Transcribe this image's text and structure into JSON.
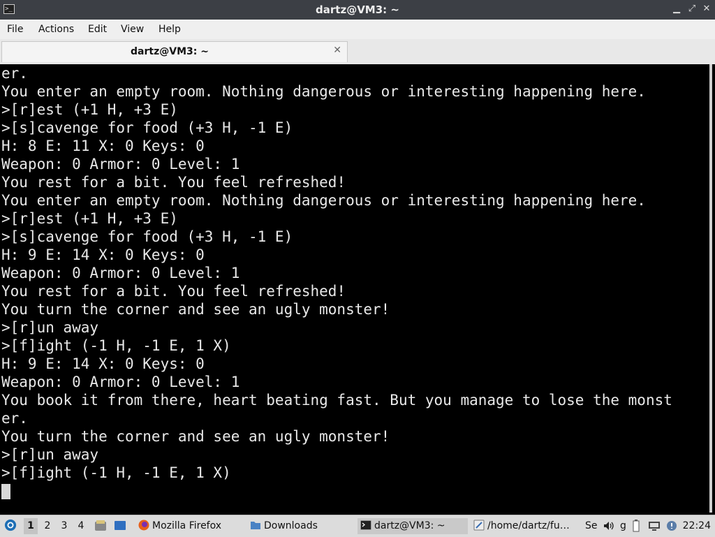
{
  "window": {
    "title": "dartz@VM3: ~",
    "minimize_glyph": "▁",
    "maximize_glyph": "⤢",
    "close_glyph": "✕"
  },
  "menu": [
    "File",
    "Actions",
    "Edit",
    "View",
    "Help"
  ],
  "tab": {
    "title": "dartz@VM3: ~",
    "close_glyph": "✕"
  },
  "terminal": {
    "lines": [
      "er.",
      "You enter an empty room. Nothing dangerous or interesting happening here.",
      ">[r]est (+1 H, +3 E)",
      ">[s]cavenge for food (+3 H, -1 E)",
      "H: 8 E: 11 X: 0 Keys: 0",
      "Weapon: 0 Armor: 0 Level: 1",
      "You rest for a bit. You feel refreshed!",
      "You enter an empty room. Nothing dangerous or interesting happening here.",
      ">[r]est (+1 H, +3 E)",
      ">[s]cavenge for food (+3 H, -1 E)",
      "H: 9 E: 14 X: 0 Keys: 0",
      "Weapon: 0 Armor: 0 Level: 1",
      "You rest for a bit. You feel refreshed!",
      "You turn the corner and see an ugly monster!",
      ">[r]un away",
      ">[f]ight (-1 H, -1 E, 1 X)",
      "H: 9 E: 14 X: 0 Keys: 0",
      "Weapon: 0 Armor: 0 Level: 1",
      "You book it from there, heart beating fast. But you manage to lose the monst",
      "er.",
      "You turn the corner and see an ugly monster!",
      ">[r]un away",
      ">[f]ight (-1 H, -1 E, 1 X)"
    ]
  },
  "taskbar": {
    "workspaces": [
      "1",
      "2",
      "3",
      "4"
    ],
    "active_workspace": "1",
    "tasks": {
      "firefox": "Mozilla Firefox",
      "downloads": "Downloads",
      "terminal": "dartz@VM3: ~",
      "editor": "/home/dartz/fu…",
      "tray_text_1": "Se",
      "tray_text_2": "g"
    },
    "clock": "22:24",
    "icons": {
      "start": "start-menu-icon",
      "files": "file-manager-icon",
      "desktop": "show-desktop-icon",
      "firefox": "firefox-icon",
      "folder": "folder-icon",
      "terminal": "terminal-icon",
      "editor": "text-editor-icon",
      "volume": "volume-icon",
      "battery": "battery-icon",
      "network": "network-icon",
      "updates": "updates-icon"
    },
    "colors": {
      "start": "#1e6fb5",
      "firefox": "#e8601a",
      "folder": "#4a82c4",
      "files": "#3b78c2",
      "desktop": "#2f6fc0"
    }
  }
}
